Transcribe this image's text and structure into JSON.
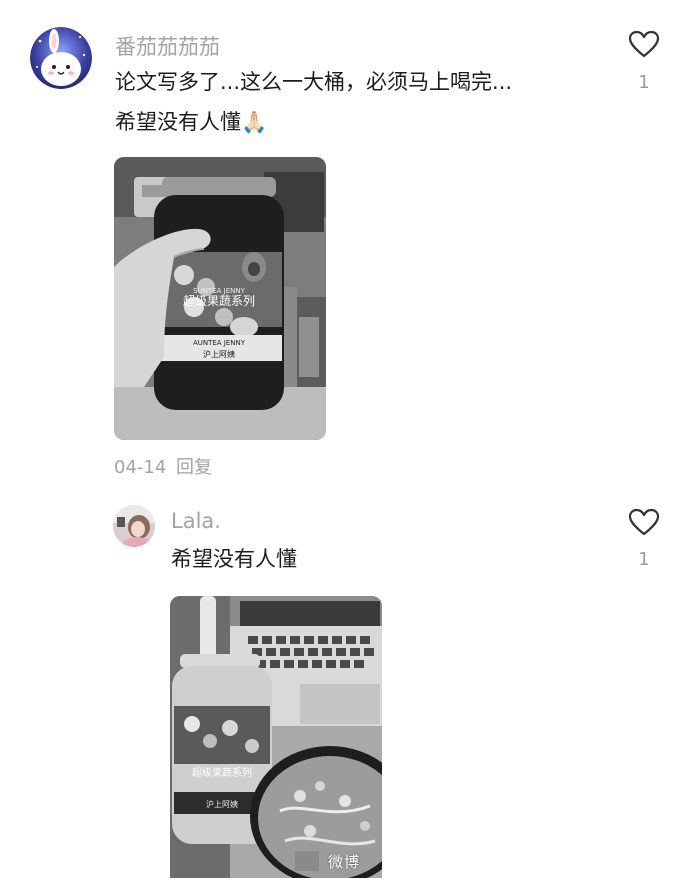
{
  "comment": {
    "username": "番茄茄茄茄",
    "text_line1": "论文写多了...这么一大桶，必须马上喝完...",
    "text_line2": "希望没有人懂🙏🏻",
    "like_count": "1",
    "date": "04-14",
    "reply_label": "回复",
    "bottle_label_line1": "SUNTEA JENNY",
    "bottle_label_line2": "超级果蔬系列",
    "bottle_label_line3": "AUNTEA JENNY",
    "bottle_label_line4": "沪上阿姨"
  },
  "reply": {
    "username": "Lala.",
    "text": "希望没有人懂",
    "like_count": "1",
    "bottle_label_line1": "超级果蔬系列",
    "bottle_label_line2": "沪上阿姨"
  },
  "watermark": "微博"
}
